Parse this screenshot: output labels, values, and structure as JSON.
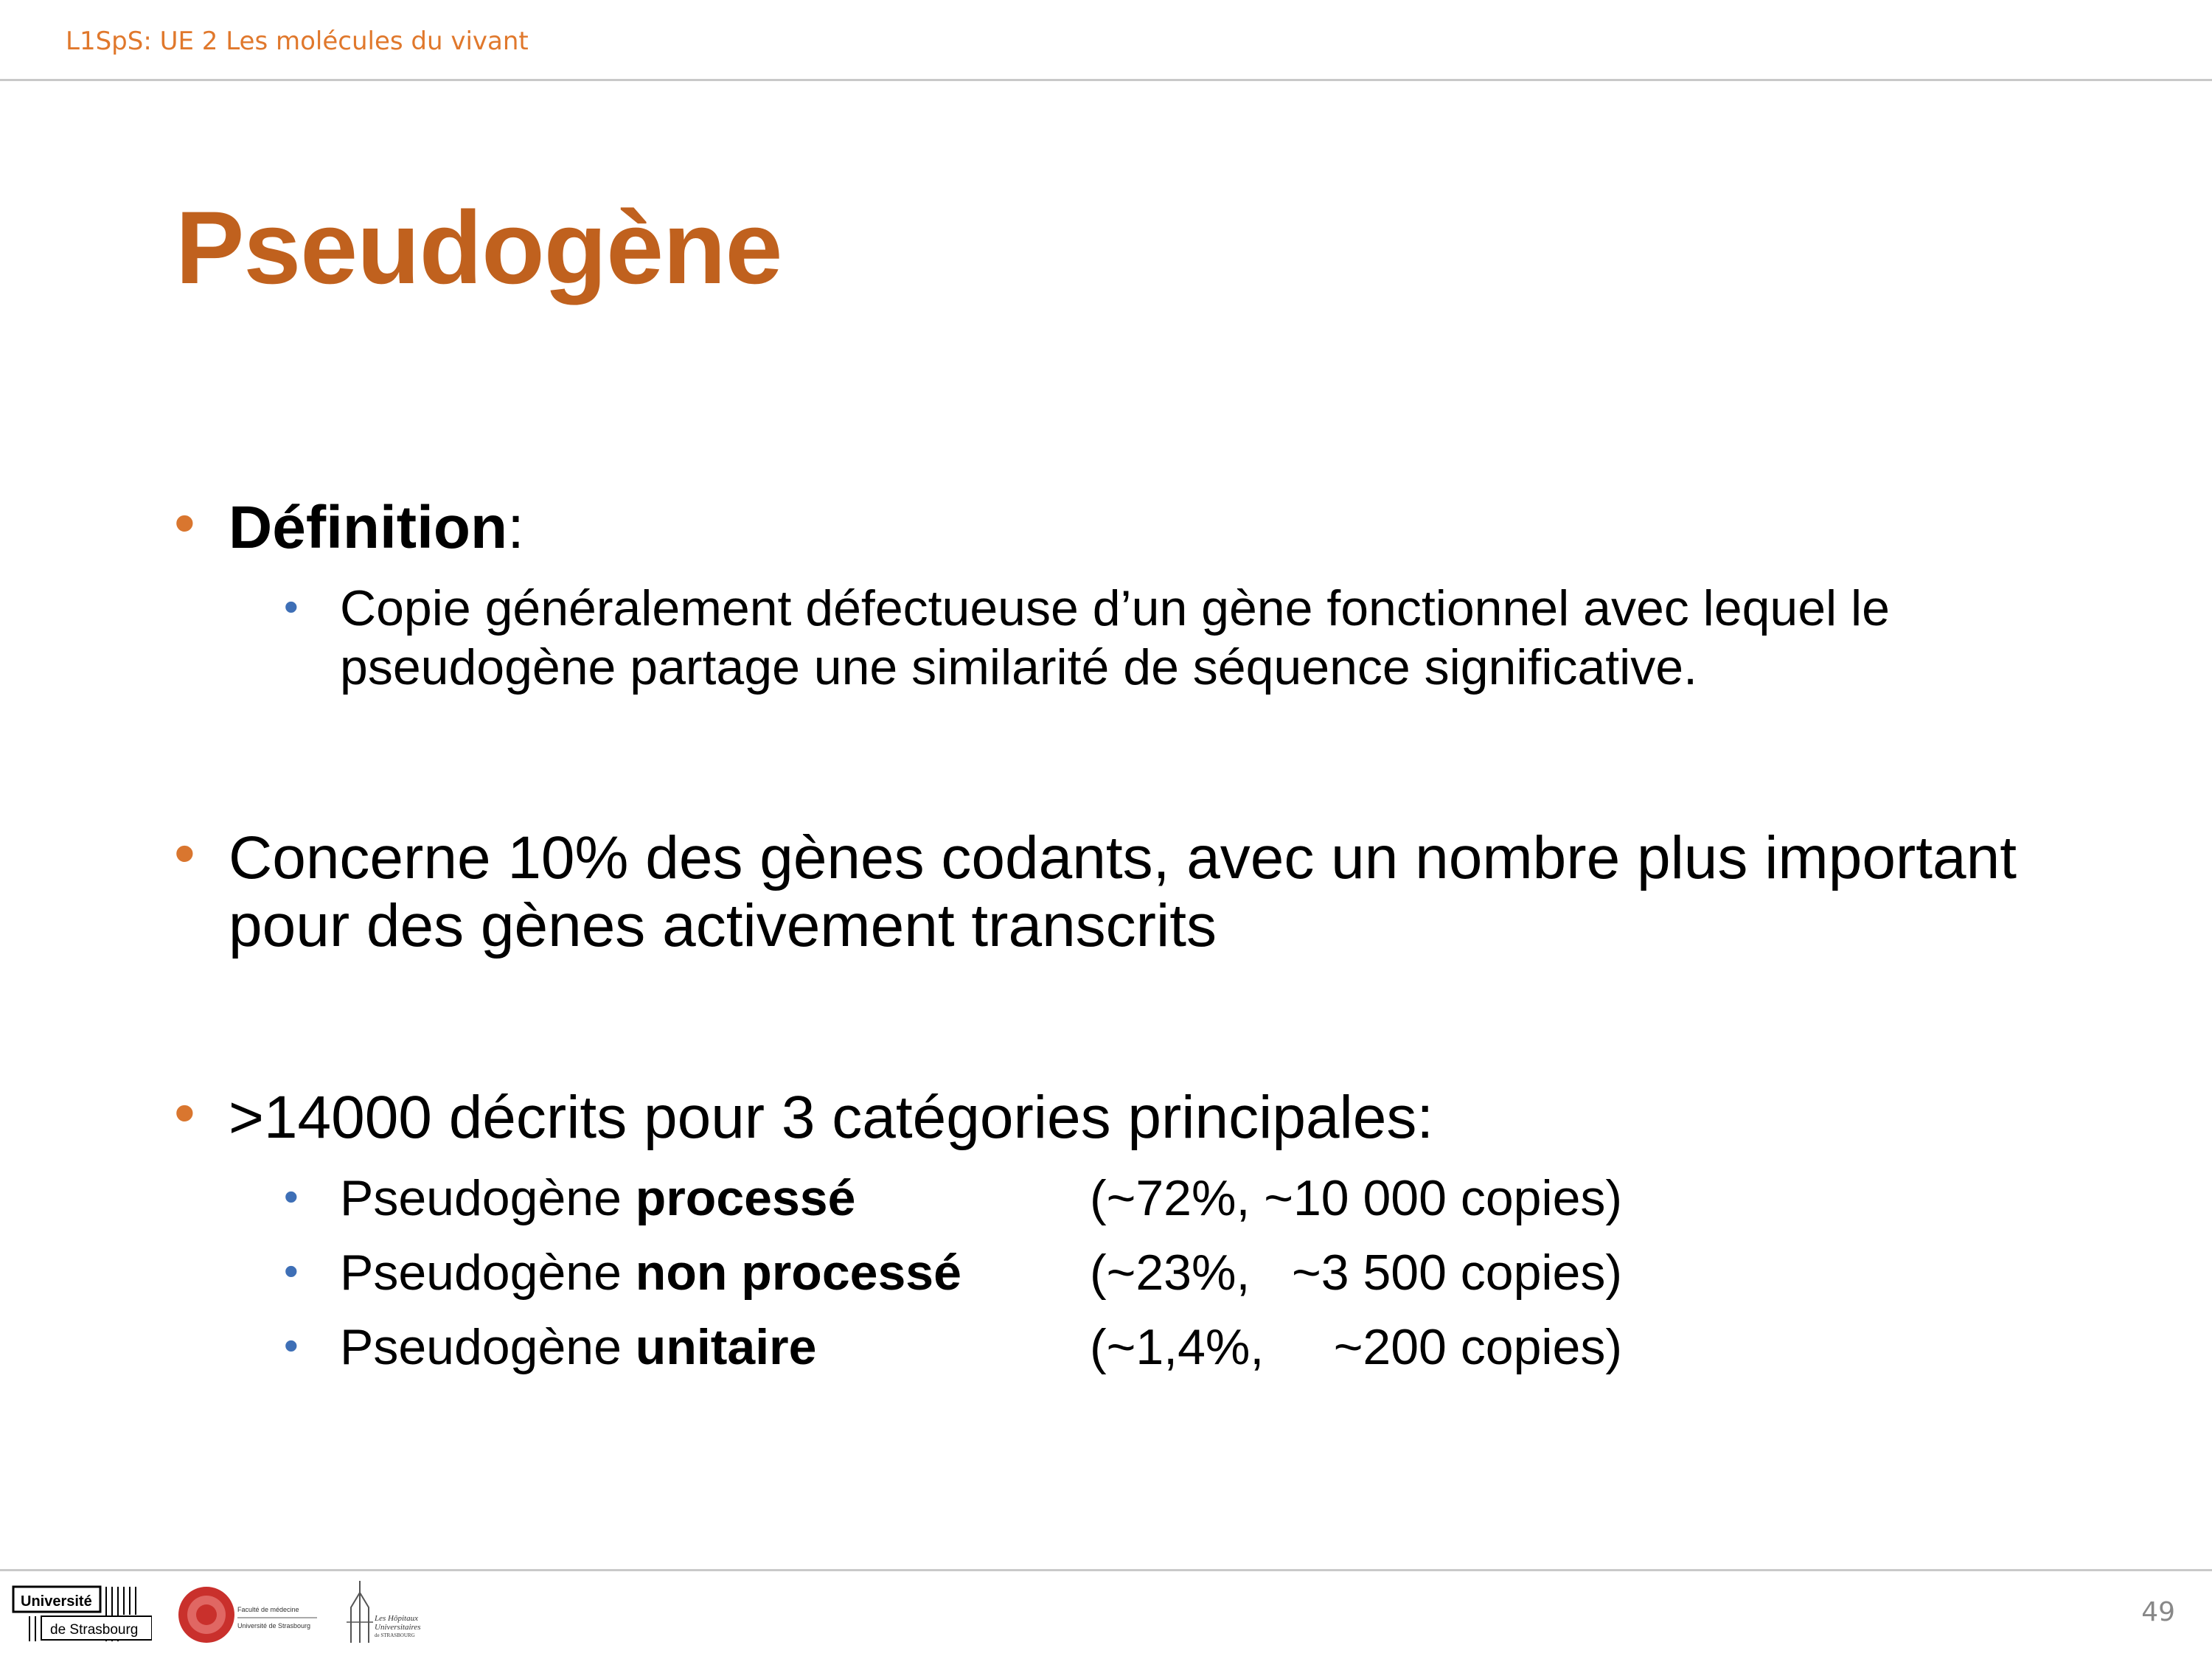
{
  "header": {
    "course": "L1SpS: UE 2 Les molécules du vivant"
  },
  "slide": {
    "title": "Pseudogène",
    "definition": {
      "label": "Définition",
      "colon": ":",
      "sub_line1": "Copie généralement défectueuse d’un gène fonctionnel avec lequel le",
      "sub_line2": "pseudogène partage une similarité de séquence significative."
    },
    "concerne": {
      "line1": "Concerne 10% des gènes codants, avec un nombre plus important",
      "line2": "pour des gènes activement transcrits"
    },
    "categories": {
      "intro": ">14000 décrits pour 3 catégories principales:",
      "items": [
        {
          "prefix": "Pseudogène ",
          "bold": "processé",
          "stats": "(~72%, ~10 000 copies)"
        },
        {
          "prefix": "Pseudogène ",
          "bold": "non processé",
          "stats": "(~23%,   ~3 500 copies)"
        },
        {
          "prefix": "Pseudogène ",
          "bold": "unitaire",
          "stats": "(~1,4%,     ~200 copies)"
        }
      ]
    },
    "bullet_char": "•"
  },
  "footer": {
    "page_number": "49",
    "logo_unistra": {
      "line1": "Université",
      "line2": "de Strasbourg"
    },
    "logo_faculte": {
      "line1": "Faculté de médecine",
      "line2": "Université de Strasbourg"
    },
    "logo_hopitaux": {
      "line1": "Les Hôpitaux",
      "line2": "Universitaires",
      "line3": "de STRASBOURG"
    }
  },
  "colors": {
    "title": "#c0611e",
    "header": "#e0782c",
    "bullet_l1": "#d9762f",
    "bullet_l2": "#3e6fb6"
  }
}
